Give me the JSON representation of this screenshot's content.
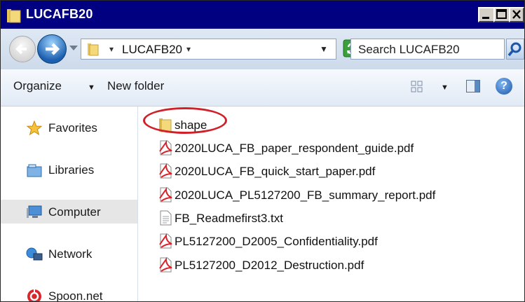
{
  "window": {
    "title": "LUCAFB20"
  },
  "address": {
    "crumb": "LUCAFB20"
  },
  "search": {
    "text": "Search LUCAFB20"
  },
  "toolbar": {
    "organize": "Organize",
    "new_folder": "New folder"
  },
  "nav": {
    "items": [
      {
        "label": "Favorites",
        "icon": "star-icon"
      },
      {
        "label": "Libraries",
        "icon": "libraries-icon"
      },
      {
        "label": "Computer",
        "icon": "computer-icon",
        "selected": true
      },
      {
        "label": "Network",
        "icon": "network-icon"
      },
      {
        "label": "Spoon.net",
        "icon": "spoon-icon"
      }
    ]
  },
  "files": [
    {
      "name": "shape",
      "type": "folder",
      "highlighted": true
    },
    {
      "name": "2020LUCA_FB_paper_respondent_guide.pdf",
      "type": "pdf"
    },
    {
      "name": "2020LUCA_FB_quick_start_paper.pdf",
      "type": "pdf"
    },
    {
      "name": "2020LUCA_PL5127200_FB_summary_report.pdf",
      "type": "pdf"
    },
    {
      "name": "FB_Readmefirst3.txt",
      "type": "txt"
    },
    {
      "name": "PL5127200_D2005_Confidentiality.pdf",
      "type": "pdf"
    },
    {
      "name": "PL5127200_D2012_Destruction.pdf",
      "type": "pdf"
    }
  ],
  "colors": {
    "titlebar": "#000080",
    "highlight_ring": "#d0202a",
    "selected_bg": "#e6e6e6"
  }
}
